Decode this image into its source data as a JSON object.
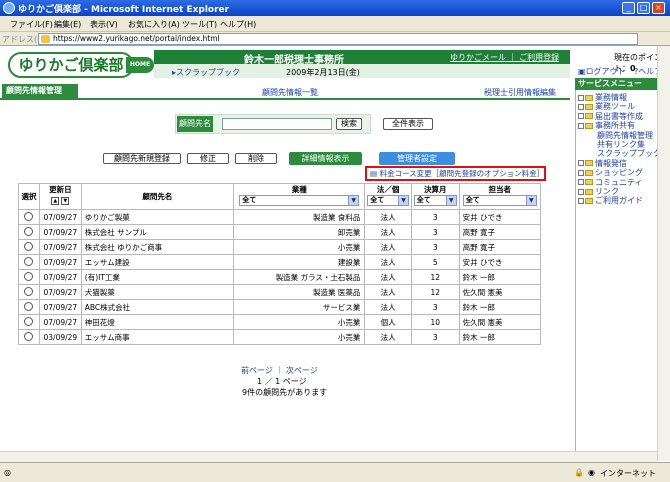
{
  "window": {
    "title": "ゆりかご倶楽部 - Microsoft Internet Explorer"
  },
  "menubar": [
    "ファイル(F)",
    "編集(E)",
    "表示(V)",
    "お気に入り(A)",
    "ツール(T)",
    "ヘルプ(H)"
  ],
  "address": {
    "label": "アドレス(D)",
    "url": "https://www2.yurikago.net/portal/index.html"
  },
  "header": {
    "logo": "ゆりかご倶楽部",
    "home": "HOME",
    "company": "鈴木一郎税理士事務所",
    "mail_links": "ゆりかごメール ｜ ご利用登録",
    "points_label": "現在のポイント：",
    "points_value": "0",
    "scrapbook": "スクラップブック",
    "date": "2009年2月13日(金)",
    "logout": "ログアウト",
    "help": "ヘルプ"
  },
  "nav": {
    "title": "顧問先情報管理",
    "center": "顧問先情報一覧",
    "right": "税理士引用情報編集"
  },
  "side_menu": {
    "title": "サービスメニュー",
    "items": [
      {
        "label": "業務情報",
        "level": 0
      },
      {
        "label": "業務ツール",
        "level": 0
      },
      {
        "label": "届出書等作成",
        "level": 0
      },
      {
        "label": "事務所共有",
        "level": 0
      },
      {
        "label": "顧問先情報管理",
        "level": 1
      },
      {
        "label": "共有リンク集",
        "level": 1
      },
      {
        "label": "スクラップブック",
        "level": 1
      },
      {
        "label": "情報発信",
        "level": 0
      },
      {
        "label": "ショッピング",
        "level": 0
      },
      {
        "label": "コミュニティ",
        "level": 0
      },
      {
        "label": "リンク",
        "level": 0
      },
      {
        "label": "ご利用ガイド",
        "level": 0
      }
    ]
  },
  "search": {
    "label": "顧問先名",
    "value": "",
    "search_button": "検索",
    "show_all_button": "全件表示"
  },
  "actions": {
    "new": "顧問先新規登録",
    "edit": "修正",
    "delete": "削除",
    "detail": "詳細情報表示",
    "admin": "管理者設定"
  },
  "option_link": "料金コース変更［顧問先登録のオプション料金］",
  "table": {
    "headers": {
      "select": "選択",
      "updated": "更新日",
      "name": "顧問先名",
      "industry": "業種",
      "type": "法／個",
      "fiscal": "決算月",
      "staff": "担当者"
    },
    "filter_all": "全て",
    "rows": [
      {
        "updated": "07/09/27",
        "name": "ゆりかご製菓",
        "industry": "製造業 食料品",
        "type": "法人",
        "fiscal": "3",
        "staff": "安井 ひでき"
      },
      {
        "updated": "07/09/27",
        "name": "株式会社 サンプル",
        "industry": "卸売業",
        "type": "法人",
        "fiscal": "3",
        "staff": "高野 寛子"
      },
      {
        "updated": "07/09/27",
        "name": "株式会社 ゆりかご商事",
        "industry": "小売業",
        "type": "法人",
        "fiscal": "3",
        "staff": "高野 寛子"
      },
      {
        "updated": "07/09/27",
        "name": "エッサム建設",
        "industry": "建設業",
        "type": "法人",
        "fiscal": "5",
        "staff": "安井 ひでき"
      },
      {
        "updated": "07/09/27",
        "name": "(有)IT工業",
        "industry": "製造業 ガラス・土石製品",
        "type": "法人",
        "fiscal": "12",
        "staff": "鈴木 一郎"
      },
      {
        "updated": "07/09/27",
        "name": "犬猫製薬",
        "industry": "製造業 医薬品",
        "type": "法人",
        "fiscal": "12",
        "staff": "佐久間 憲美"
      },
      {
        "updated": "07/09/27",
        "name": "ABC株式会社",
        "industry": "サービス業",
        "type": "法人",
        "fiscal": "3",
        "staff": "鈴木 一郎"
      },
      {
        "updated": "07/09/27",
        "name": "神田花燈",
        "industry": "小売業",
        "type": "個人",
        "fiscal": "10",
        "staff": "佐久間 憲美"
      },
      {
        "updated": "03/09/29",
        "name": "エッサム商事",
        "industry": "小売業",
        "type": "法人",
        "fiscal": "3",
        "staff": "鈴木 一郎"
      }
    ]
  },
  "pager": {
    "links": "前ページ ｜ 次ページ",
    "page_info": "1 ／ 1 ページ",
    "count": "9件の顧問先があります"
  },
  "status": {
    "zone": "インターネット"
  }
}
